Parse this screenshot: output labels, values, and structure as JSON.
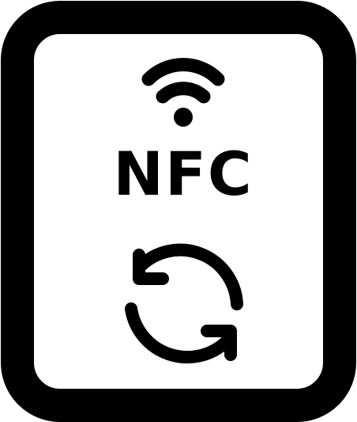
{
  "icon": {
    "name": "nfc-refresh-icon",
    "label": "NFC",
    "colors": {
      "stroke": "#000000",
      "background": "#ffffff"
    }
  }
}
